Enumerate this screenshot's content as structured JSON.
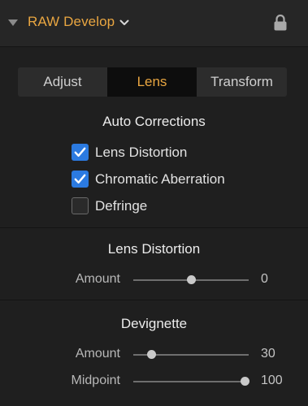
{
  "header": {
    "title": "RAW Develop",
    "accent_color": "#e9a641",
    "icons": [
      "disclosure-triangle-icon",
      "chevron-down-icon",
      "lock-icon"
    ]
  },
  "tabs": [
    {
      "label": "Adjust",
      "selected": false
    },
    {
      "label": "Lens",
      "selected": true
    },
    {
      "label": "Transform",
      "selected": false
    }
  ],
  "auto_corrections": {
    "title": "Auto Corrections",
    "check_color": "#2b7ae0",
    "items": [
      {
        "label": "Lens Distortion",
        "checked": true
      },
      {
        "label": "Chromatic Aberration",
        "checked": true
      },
      {
        "label": "Defringe",
        "checked": false
      }
    ]
  },
  "lens_distortion": {
    "title": "Lens Distortion",
    "amount": {
      "label": "Amount",
      "value": "0",
      "fraction": 0.5
    }
  },
  "devignette": {
    "title": "Devignette",
    "amount": {
      "label": "Amount",
      "value": "30",
      "fraction": 0.16
    },
    "midpoint": {
      "label": "Midpoint",
      "value": "100",
      "fraction": 0.97
    }
  }
}
